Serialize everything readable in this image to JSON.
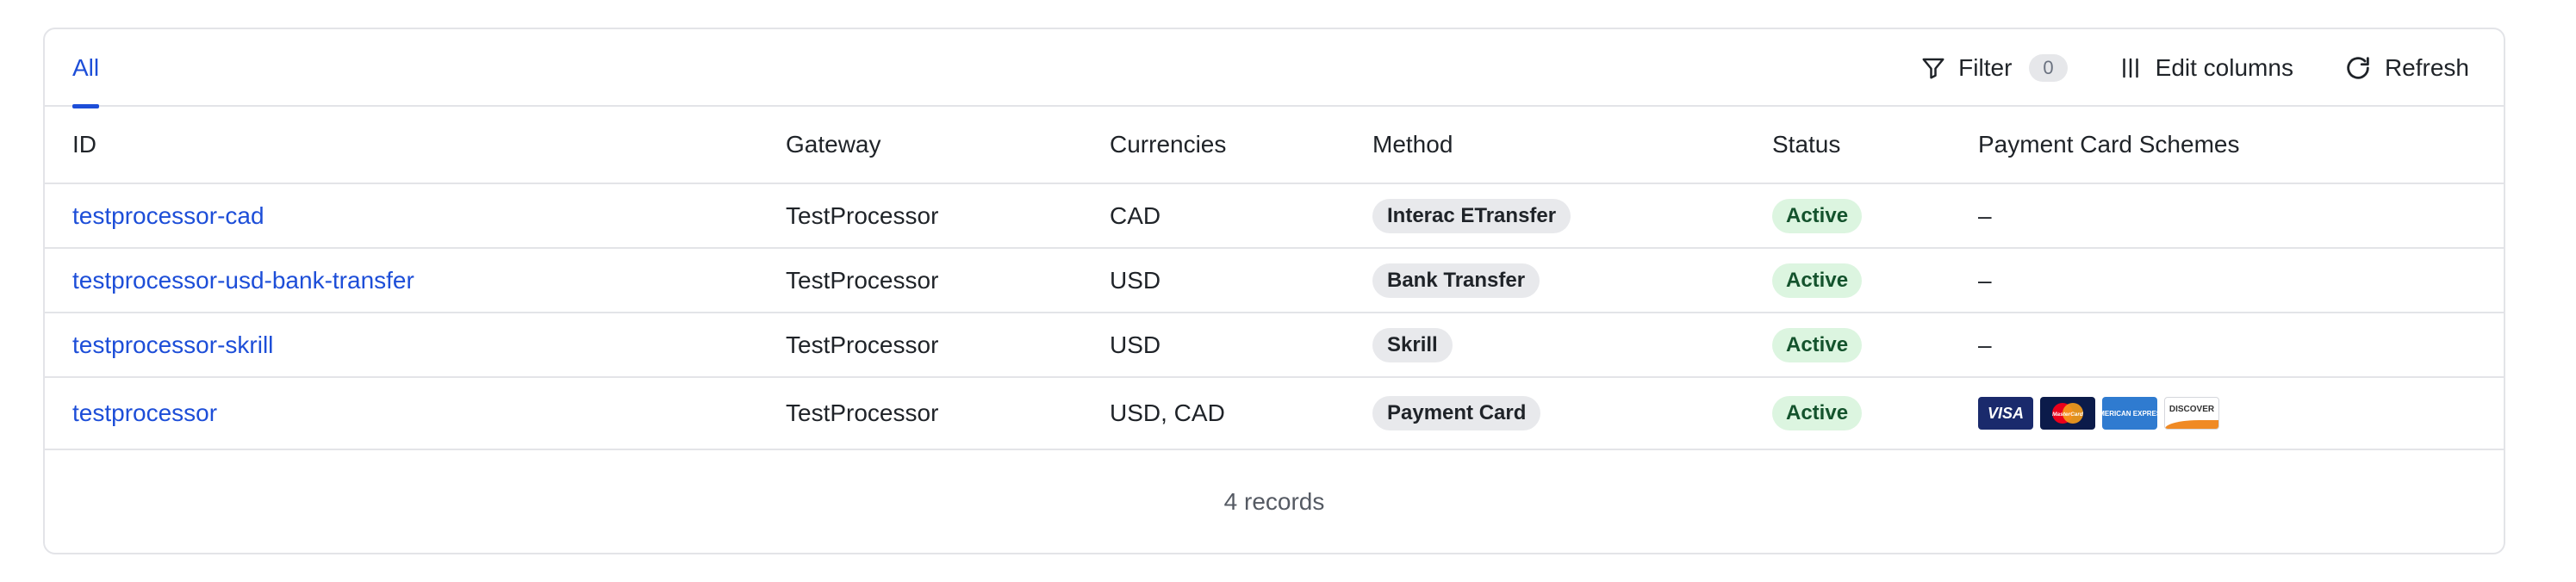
{
  "tabs": {
    "active_label": "All"
  },
  "toolbar": {
    "filter_label": "Filter",
    "filter_count": "0",
    "edit_columns_label": "Edit columns",
    "refresh_label": "Refresh"
  },
  "table": {
    "headers": {
      "id": "ID",
      "gateway": "Gateway",
      "currencies": "Currencies",
      "method": "Method",
      "status": "Status",
      "card_schemes": "Payment Card Schemes"
    },
    "rows": [
      {
        "id": "testprocessor-cad",
        "gateway": "TestProcessor",
        "currencies": "CAD",
        "method": "Interac ETransfer",
        "status": "Active",
        "card_schemes": "–"
      },
      {
        "id": "testprocessor-usd-bank-transfer",
        "gateway": "TestProcessor",
        "currencies": "USD",
        "method": "Bank Transfer",
        "status": "Active",
        "card_schemes": "–"
      },
      {
        "id": "testprocessor-skrill",
        "gateway": "TestProcessor",
        "currencies": "USD",
        "method": "Skrill",
        "status": "Active",
        "card_schemes": "–"
      },
      {
        "id": "testprocessor",
        "gateway": "TestProcessor",
        "currencies": "USD, CAD",
        "method": "Payment Card",
        "status": "Active",
        "card_schemes": "",
        "card_logos": [
          {
            "icon": "visa-logo-icon",
            "text": "VISA"
          },
          {
            "icon": "mastercard-logo-icon",
            "text": "MasterCard"
          },
          {
            "icon": "amex-logo-icon",
            "text": "AMERICAN EXPRESS"
          },
          {
            "icon": "discover-logo-icon",
            "text": "DISCOVER"
          }
        ]
      }
    ]
  },
  "footer": {
    "records_label": "4 records"
  },
  "colors": {
    "link": "#1d4ed8",
    "border": "#e3e4e8",
    "status_bg": "#dcf5e0",
    "pill_bg": "#e8e9ec"
  }
}
